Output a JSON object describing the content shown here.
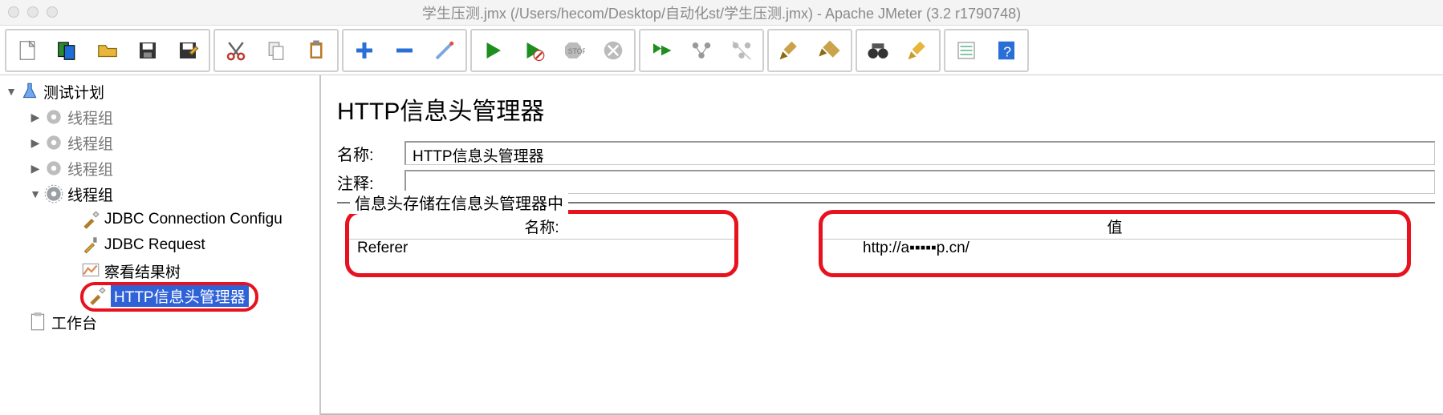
{
  "window": {
    "title": "学生压测.jmx (/Users/hecom/Desktop/自动化st/学生压测.jmx) - Apache JMeter (3.2 r1790748)"
  },
  "toolbar": {
    "icons": [
      "new",
      "templates",
      "open",
      "save",
      "save-as",
      "cut",
      "copy",
      "paste",
      "plus",
      "minus",
      "expand",
      "run",
      "run-no-timers",
      "stop",
      "shutdown",
      "toggle",
      "remote-start",
      "remote-stop",
      "clear",
      "clear-all",
      "search",
      "reset-search",
      "options",
      "help"
    ]
  },
  "tree": {
    "root": "测试计划",
    "threadGroupDisabled": "线程组",
    "threadGroupActive": "线程组",
    "jdbcConfig": "JDBC Connection Configu",
    "jdbcRequest": "JDBC Request",
    "resultsTree": "察看结果树",
    "httpHeaderMgr": "HTTP信息头管理器",
    "workbench": "工作台"
  },
  "editor": {
    "title": "HTTP信息头管理器",
    "nameLabel": "名称:",
    "nameValue": "HTTP信息头管理器",
    "commentLabel": "注释:",
    "commentValue": "",
    "fieldsetLegend": "信息头存储在信息头管理器中",
    "table": {
      "nameHeader": "名称:",
      "valueHeader": "值",
      "rows": [
        {
          "name": "Referer",
          "value": "http://a▪▪▪▪▪p.cn/"
        }
      ]
    }
  }
}
